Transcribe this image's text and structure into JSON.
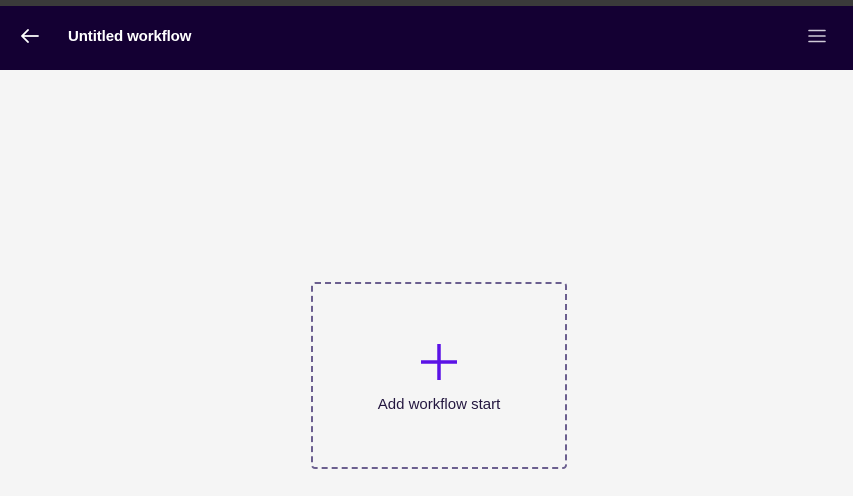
{
  "header": {
    "title": "Untitled workflow",
    "back_icon": "arrow-left-icon",
    "menu_icon": "hamburger-menu-icon",
    "background_color": "#140033"
  },
  "canvas": {
    "start_box": {
      "label": "Add workflow start",
      "icon": "plus-icon",
      "accent_color": "#5b12e6"
    }
  }
}
